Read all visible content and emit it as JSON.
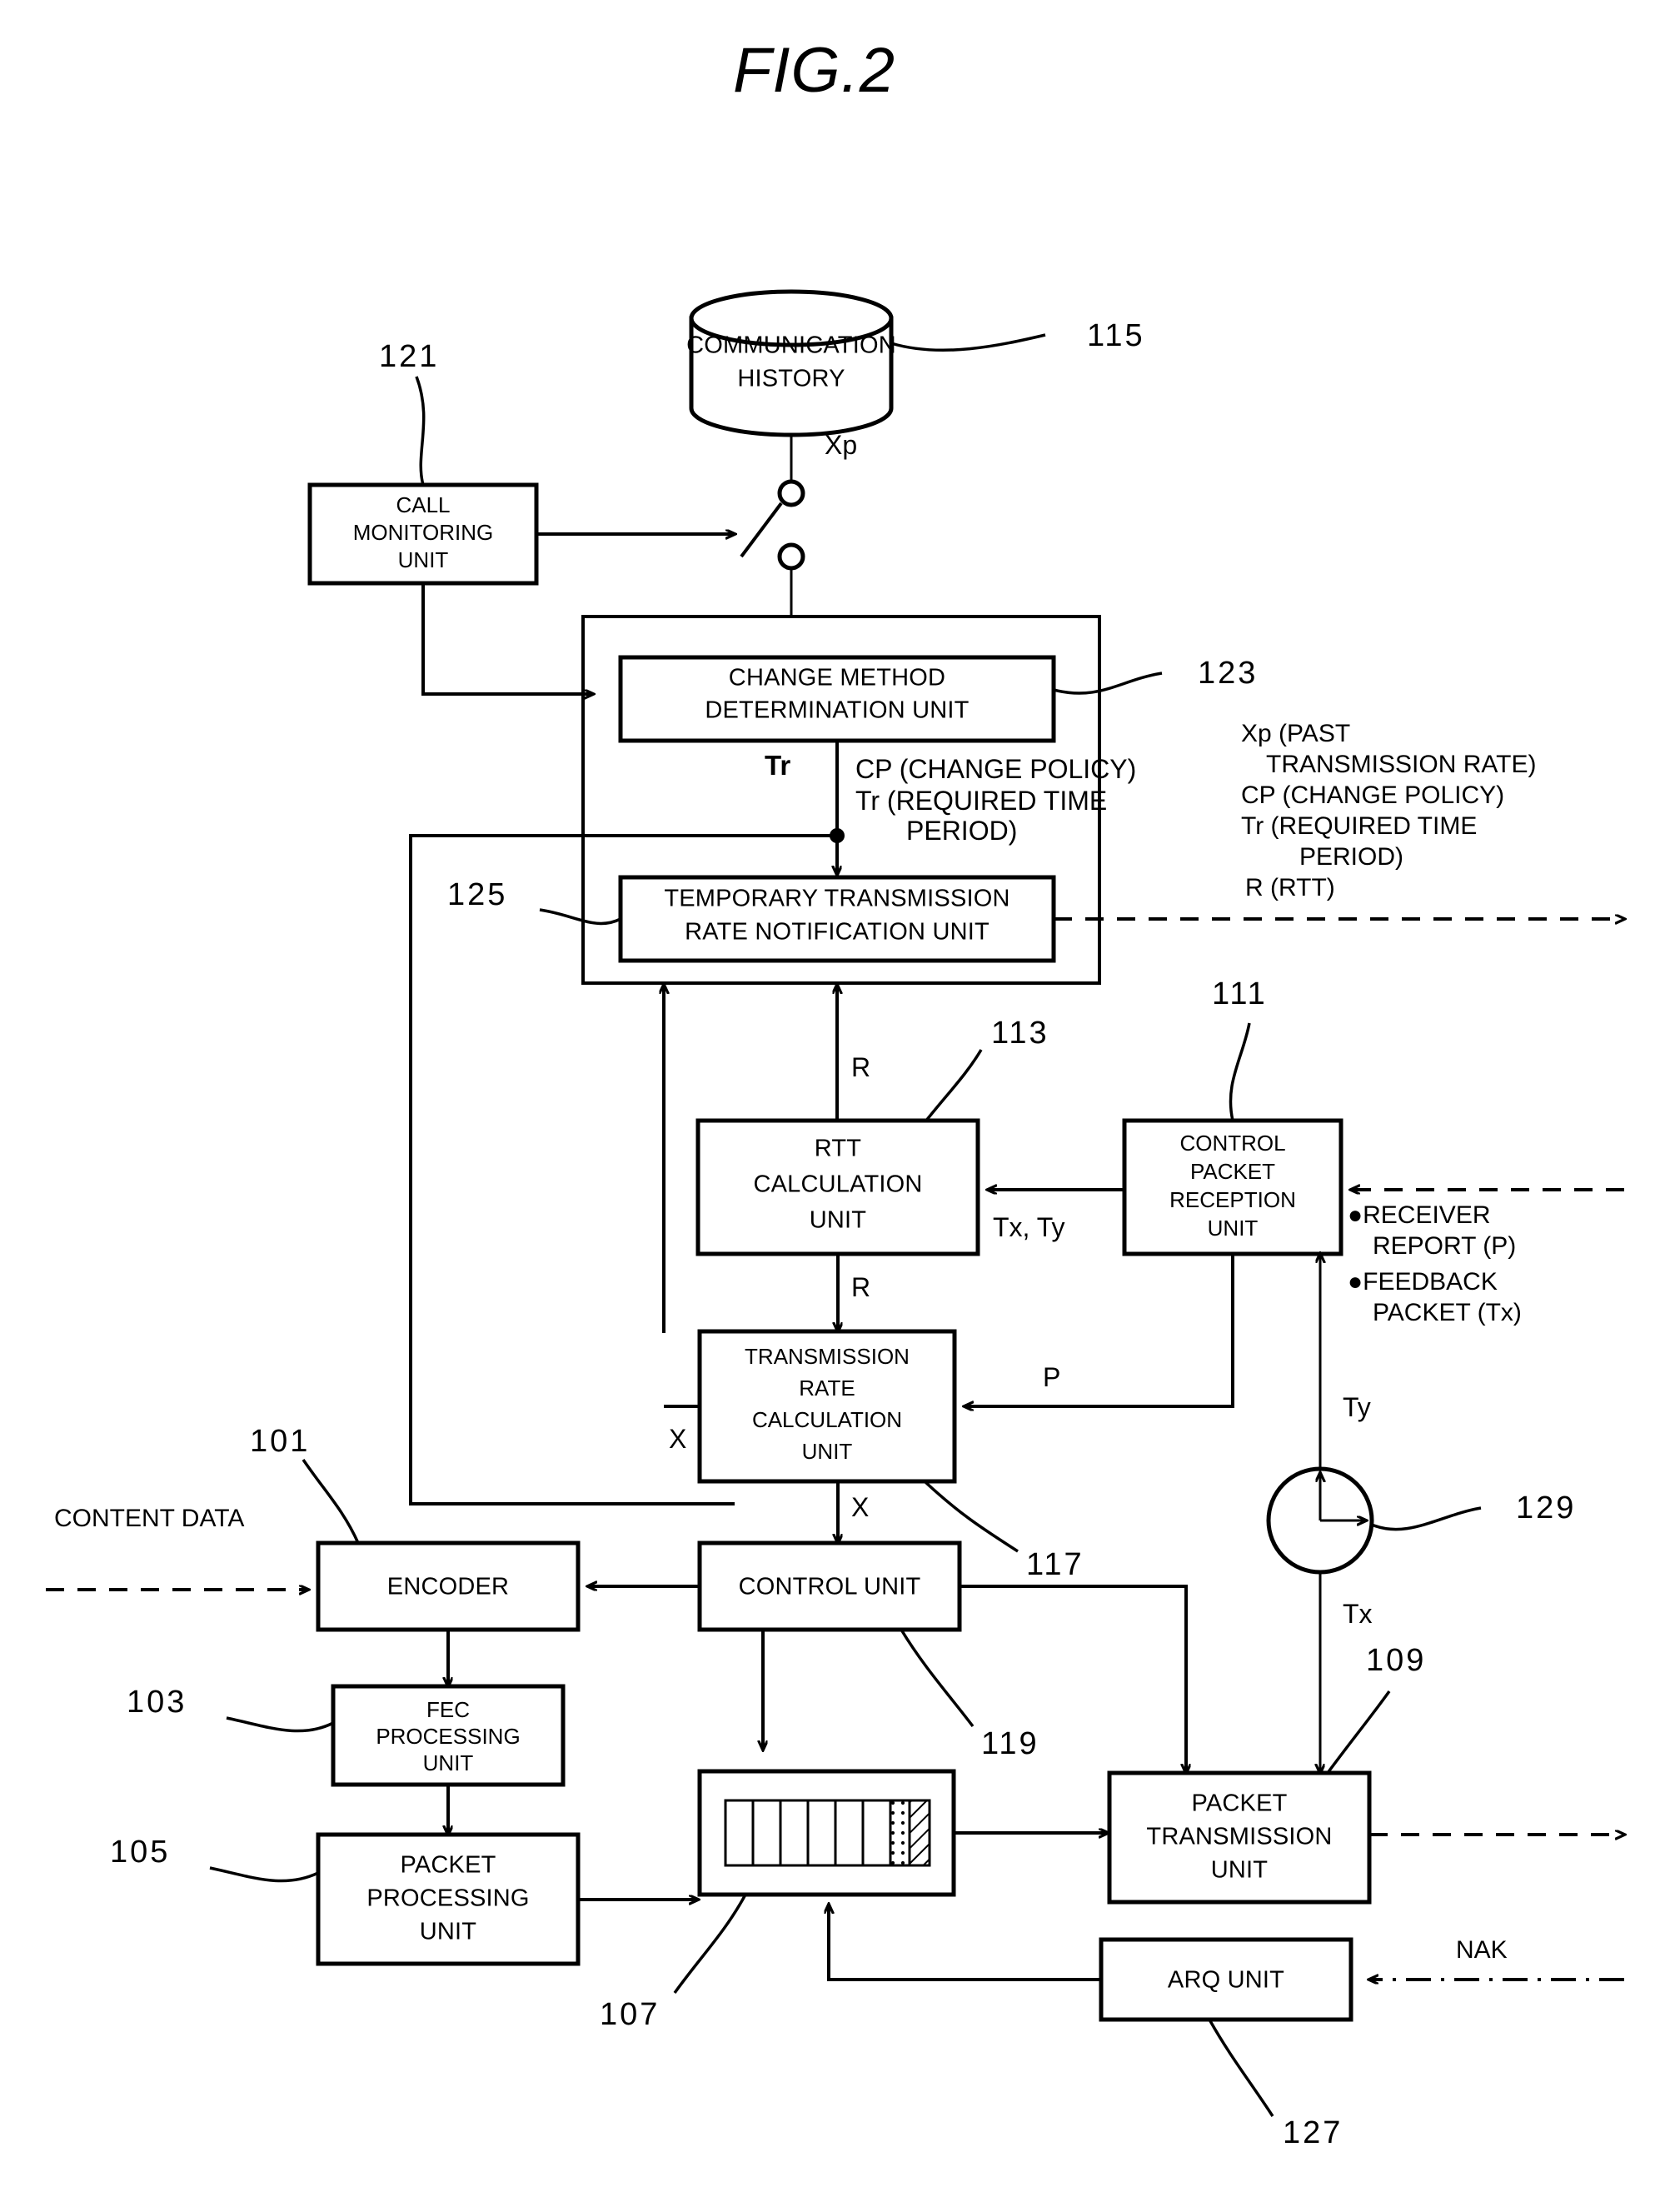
{
  "figure": {
    "title": "FIG.2",
    "type": "patent-block-diagram"
  },
  "blocks": {
    "communication_history": {
      "label_line1": "COMMUNICATION",
      "label_line2": "HISTORY",
      "ref": "115"
    },
    "call_monitoring": {
      "label_line1": "CALL",
      "label_line2": "MONITORING",
      "label_line3": "UNIT",
      "ref": "121"
    },
    "change_method": {
      "label_line1": "CHANGE METHOD",
      "label_line2": "DETERMINATION UNIT",
      "ref": "123"
    },
    "temp_rate_notify": {
      "label_line1": "TEMPORARY TRANSMISSION",
      "label_line2": "RATE NOTIFICATION UNIT",
      "ref": "125"
    },
    "rtt_calc": {
      "label_line1": "RTT",
      "label_line2": "CALCULATION",
      "label_line3": "UNIT",
      "ref": "113"
    },
    "control_packet_rx": {
      "label_line1": "CONTROL",
      "label_line2": "PACKET",
      "label_line3": "RECEPTION",
      "label_line4": "UNIT",
      "ref": "111"
    },
    "tx_rate_calc": {
      "label_line1": "TRANSMISSION",
      "label_line2": "RATE",
      "label_line3": "CALCULATION",
      "label_line4": "UNIT",
      "ref": "117"
    },
    "encoder": {
      "label": "ENCODER",
      "ref": "101"
    },
    "fec_processing": {
      "label_line1": "FEC",
      "label_line2": "PROCESSING",
      "label_line3": "UNIT",
      "ref": "103"
    },
    "packet_processing": {
      "label_line1": "PACKET",
      "label_line2": "PROCESSING",
      "label_line3": "UNIT",
      "ref": "105"
    },
    "buffer": {
      "ref": "107",
      "cells_empty": 6,
      "cells_dotted": 1,
      "cells_hatched": 1
    },
    "control_unit": {
      "label": "CONTROL UNIT",
      "ref": "119"
    },
    "packet_transmission": {
      "label_line1": "PACKET",
      "label_line2": "TRANSMISSION",
      "label_line3": "UNIT",
      "ref": "109"
    },
    "arq_unit": {
      "label": "ARQ UNIT",
      "ref": "127"
    },
    "clock": {
      "ref": "129"
    }
  },
  "signals": {
    "xp": "Xp",
    "tr_bold": "Tr",
    "cp_line1": "CP (CHANGE POLICY)",
    "cp_line2": "Tr (REQUIRED TIME",
    "cp_line3": "PERIOD)",
    "r_upper": "R",
    "r_lower": "R",
    "tx_ty": "Tx, Ty",
    "p": "P",
    "x_left": "X",
    "x_lower": "X",
    "ty": "Ty",
    "tx": "Tx",
    "content_data": "CONTENT DATA",
    "nak": "NAK"
  },
  "annotations": {
    "right_block": {
      "line1": "Xp (PAST",
      "line2": "TRANSMISSION RATE)",
      "line3": "CP (CHANGE POLICY)",
      "line4": "Tr (REQUIRED TIME",
      "line5": "PERIOD)",
      "line6": "R (RTT)"
    },
    "rx_bullets": {
      "b1_line1": "●RECEIVER",
      "b1_line2": "REPORT (P)",
      "b2_line1": "●FEEDBACK",
      "b2_line2": "PACKET (Tx)"
    }
  },
  "colors": {
    "ink": "#000000",
    "paper": "#ffffff"
  }
}
